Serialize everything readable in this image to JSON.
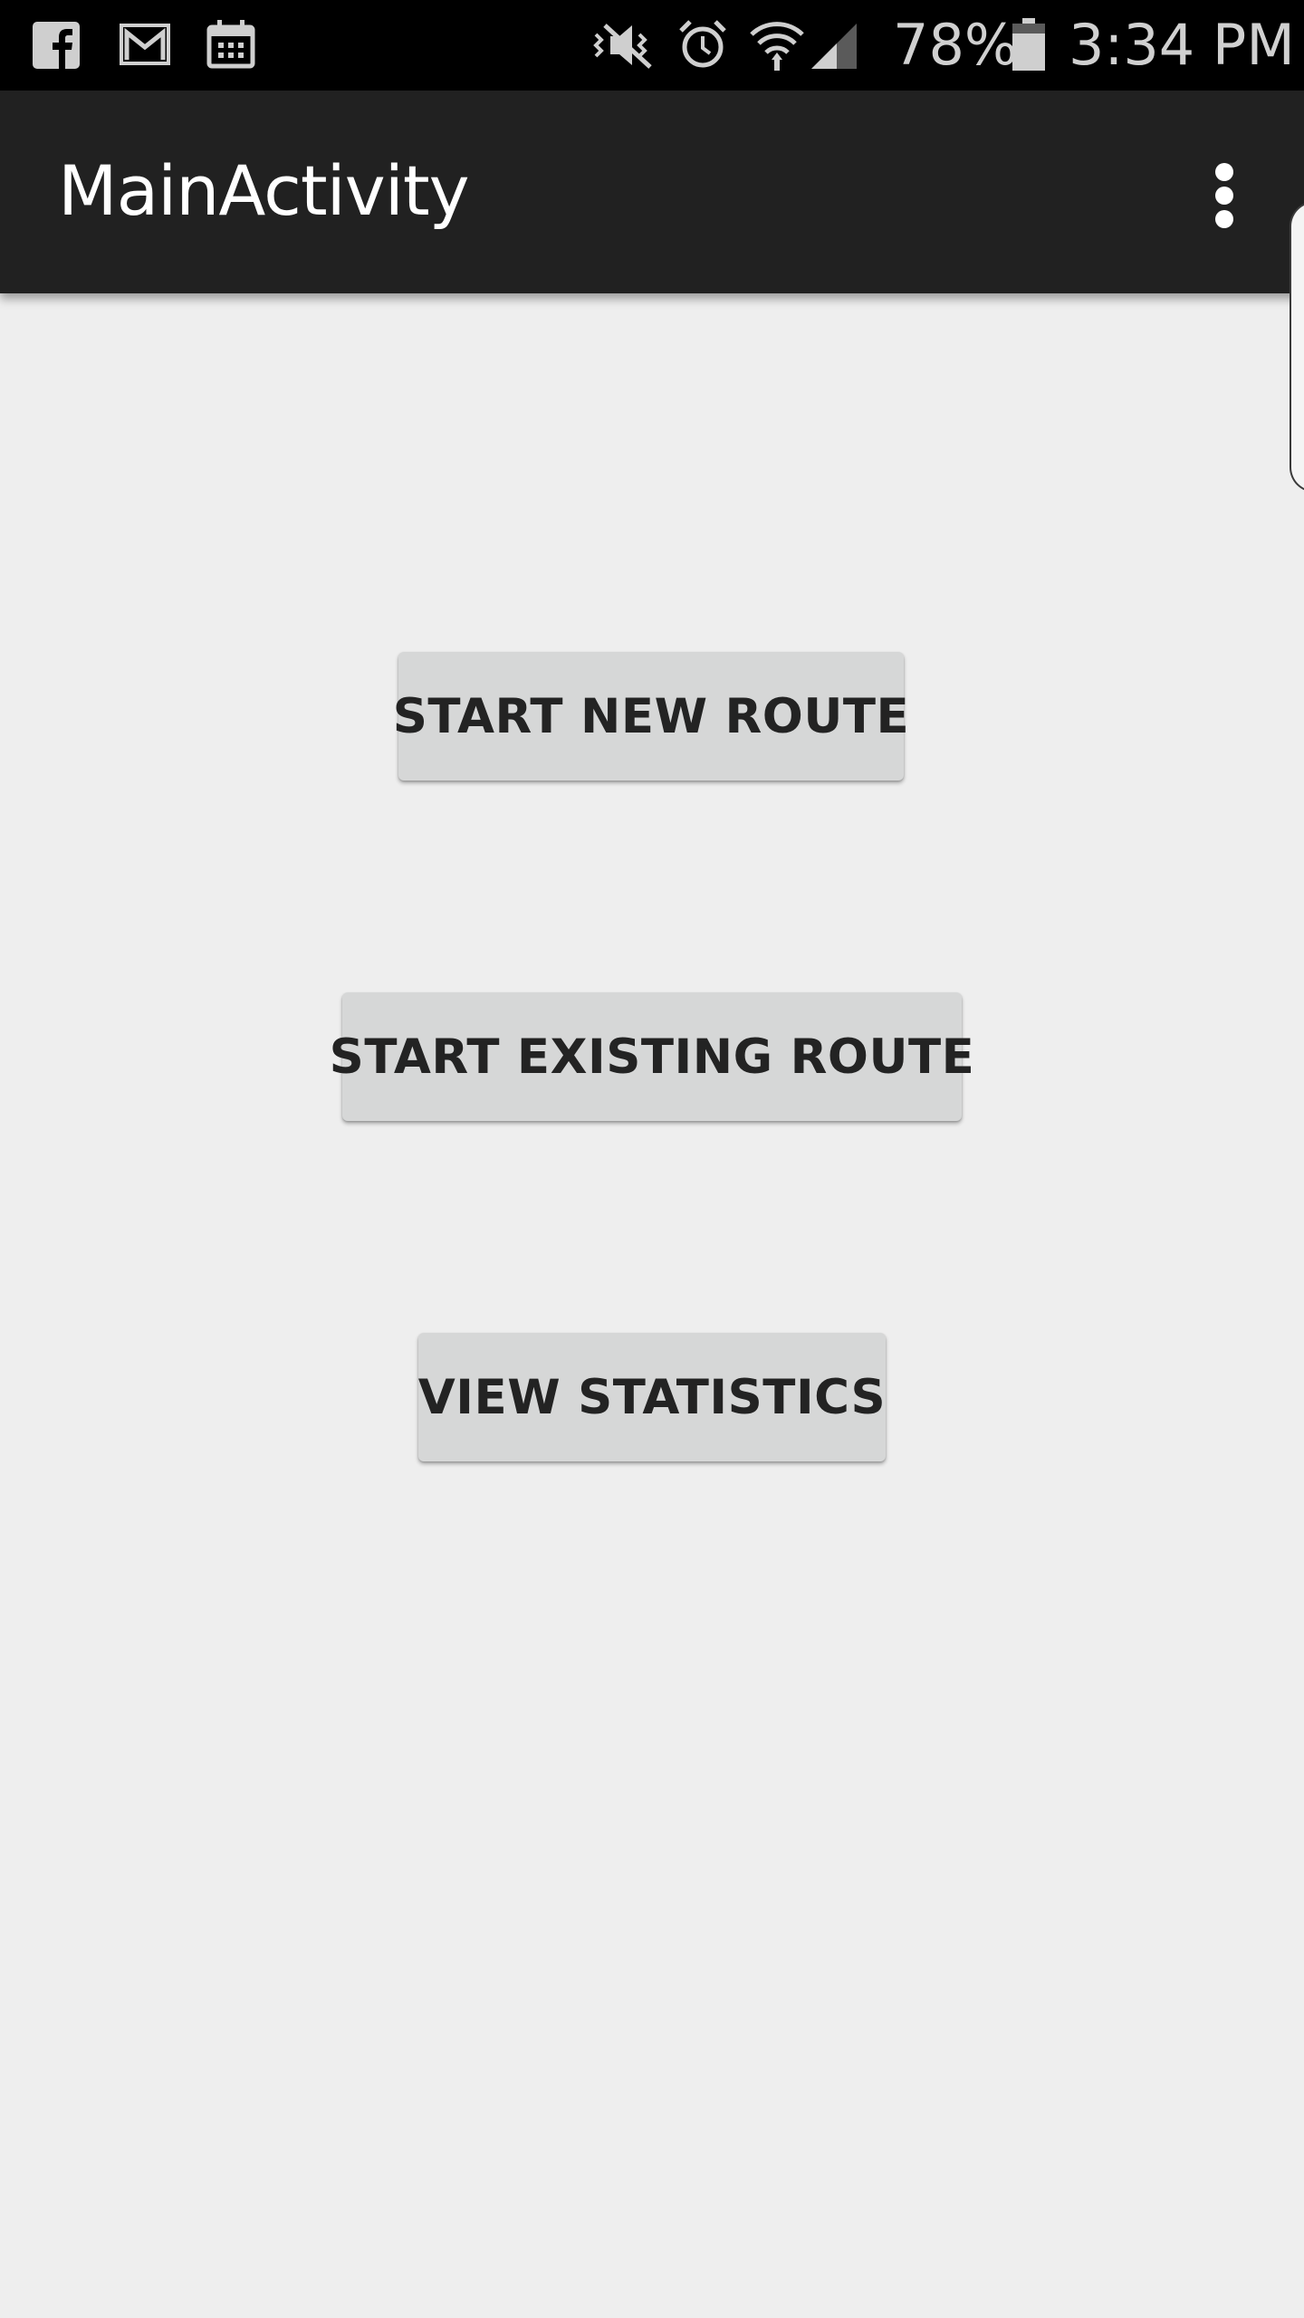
{
  "status_bar": {
    "notification_icons": [
      "facebook-icon",
      "gmail-icon",
      "calendar-icon"
    ],
    "system_icons": [
      "vibrate-mute-icon",
      "alarm-icon",
      "wifi-icon",
      "cell-signal-icon"
    ],
    "battery_percent": "78%",
    "battery_level": 0.78,
    "time": "3:34 PM"
  },
  "app_bar": {
    "title": "MainActivity",
    "overflow_icon": "more-vert-icon",
    "background_color": "#212121"
  },
  "main": {
    "buttons": [
      {
        "label": "START NEW ROUTE"
      },
      {
        "label": "START EXISTING ROUTE"
      },
      {
        "label": "VIEW STATISTICS"
      }
    ],
    "button_color": "#d6d7d7",
    "background_color": "#eeeeee"
  }
}
